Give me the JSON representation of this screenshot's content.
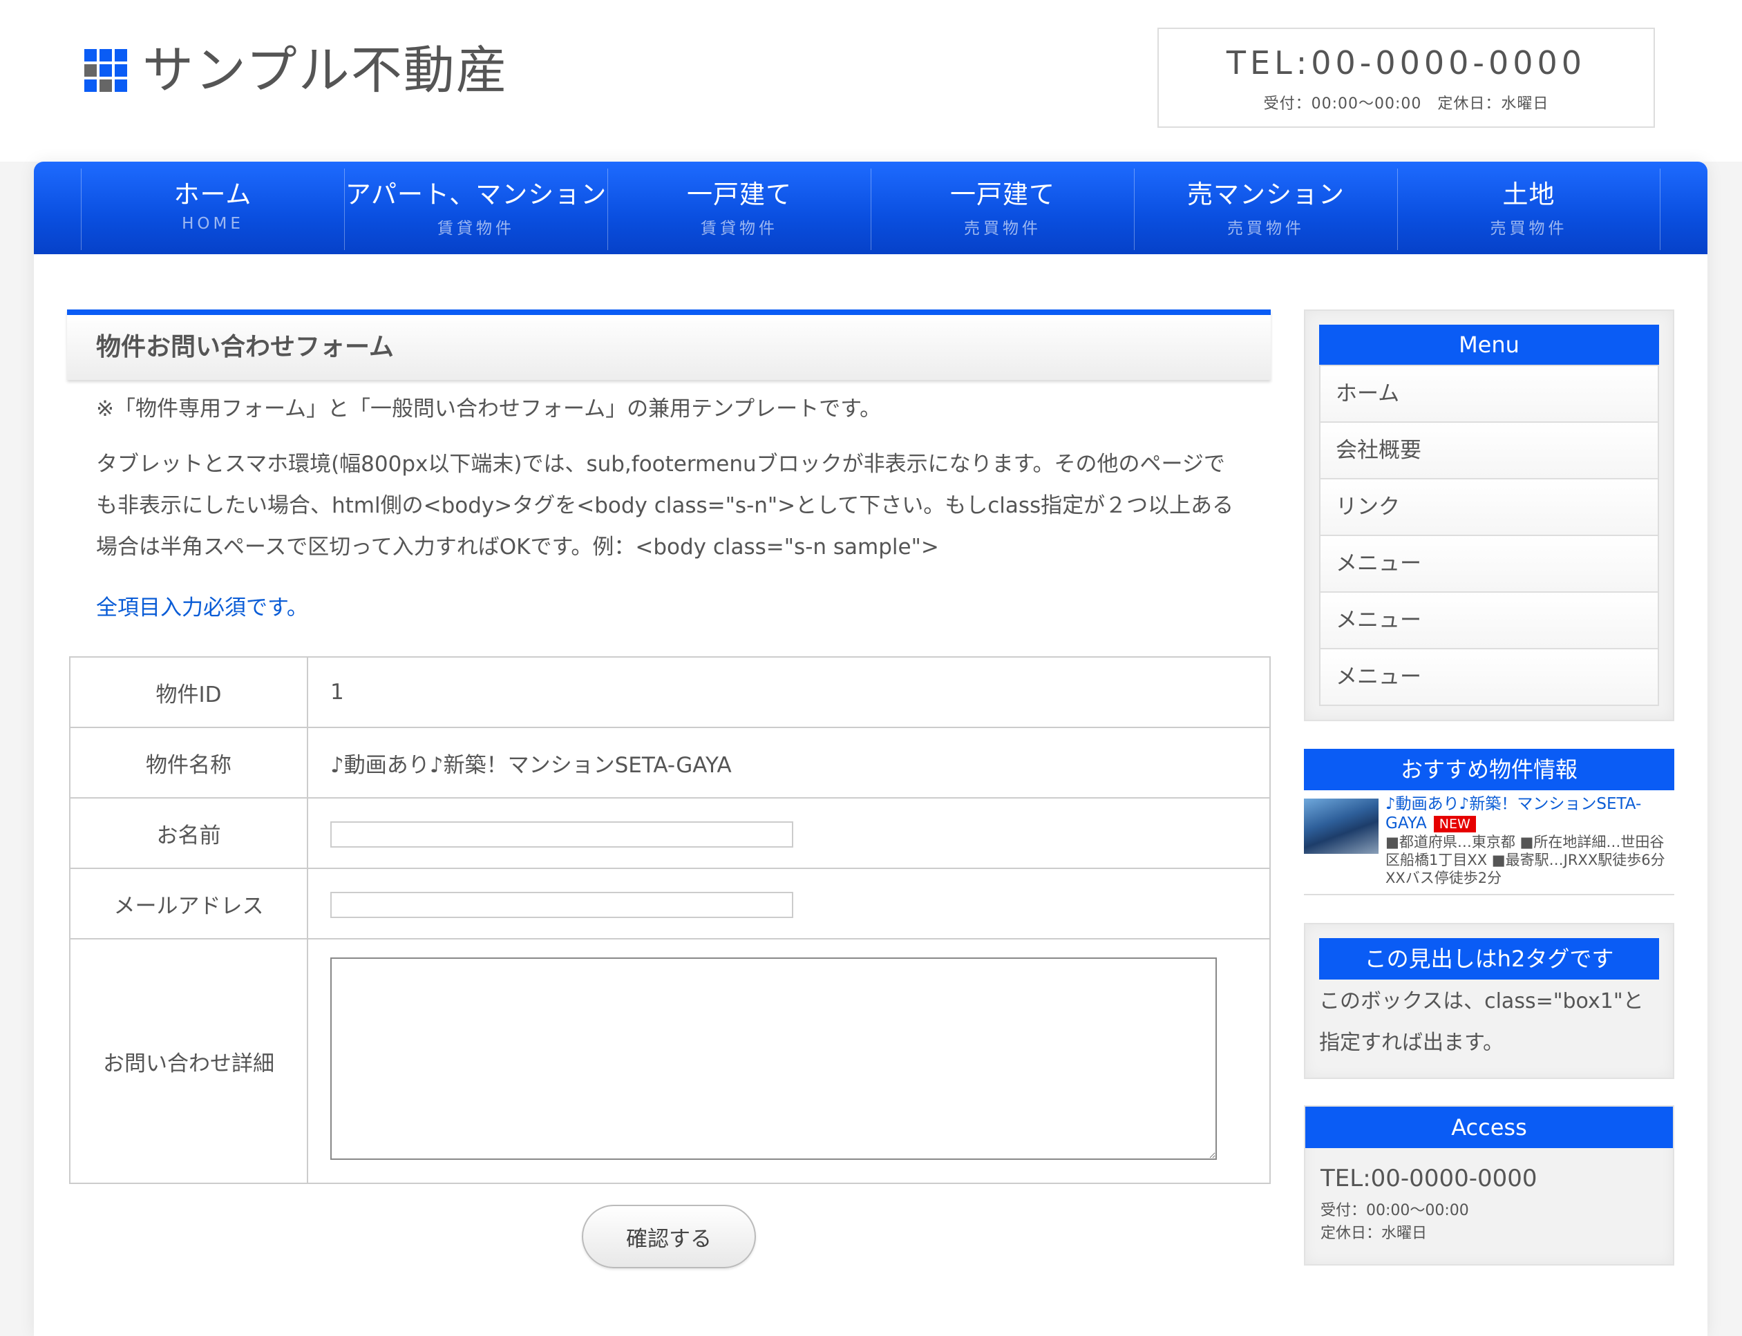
{
  "header": {
    "site_name": "サンプル不動産",
    "tel": "TEL:00-0000-0000",
    "hours": "受付：00:00〜00:00　定休日：水曜日"
  },
  "gnav": [
    {
      "label": "ホーム",
      "sub": "HOME"
    },
    {
      "label": "アパート、マンション",
      "sub": "賃貸物件"
    },
    {
      "label": "一戸建て",
      "sub": "賃貸物件"
    },
    {
      "label": "一戸建て",
      "sub": "売買物件"
    },
    {
      "label": "売マンション",
      "sub": "売買物件"
    },
    {
      "label": "土地",
      "sub": "売買物件"
    }
  ],
  "main": {
    "title": "物件お問い合わせフォーム",
    "note1": "※「物件専用フォーム」と「一般問い合わせフォーム」の兼用テンプレートです。",
    "note2": "タブレットとスマホ環境(幅800px以下端末)では、sub,footermenuブロックが非表示になります。その他のページでも非表示にしたい場合、html側の<body>タグを<body class=\"s-n\">として下さい。もしclass指定が２つ以上ある場合は半角スペースで区切って入力すればOKです。例：<body class=\"s-n sample\">",
    "required": "全項目入力必須です。",
    "form": {
      "rows": [
        {
          "label": "物件ID",
          "value": "1"
        },
        {
          "label": "物件名称",
          "value": "♪動画あり♪新築！マンションSETA-GAYA"
        },
        {
          "label": "お名前",
          "value": ""
        },
        {
          "label": "メールアドレス",
          "value": ""
        },
        {
          "label": "お問い合わせ詳細",
          "value": ""
        }
      ],
      "submit": "確認する"
    }
  },
  "sidebar": {
    "menu_title": "Menu",
    "menu_items": [
      "ホーム",
      "会社概要",
      "リンク",
      "メニュー",
      "メニュー",
      "メニュー"
    ],
    "recommend": {
      "title": "おすすめ物件情報",
      "item_title": "♪動画あり♪新築！マンションSETA-GAYA",
      "badge": "NEW",
      "desc": "■都道府県…東京都 ■所在地詳細…世田谷区船橋1丁目XX ■最寄駅…JRXX駅徒歩6分XXバス停徒歩2分"
    },
    "h2box": {
      "title": "この見出しはh2タグです",
      "body": "このボックスは、class=\"box1\"と指定すれば出ます。"
    },
    "access": {
      "title": "Access",
      "tel": "TEL:00-0000-0000",
      "hours": "受付：00:00〜00:00",
      "holiday": "定休日：水曜日"
    }
  },
  "colors": {
    "accent": "#0a5cf5",
    "link": "#0a5cd6",
    "badge": "#e60000"
  }
}
